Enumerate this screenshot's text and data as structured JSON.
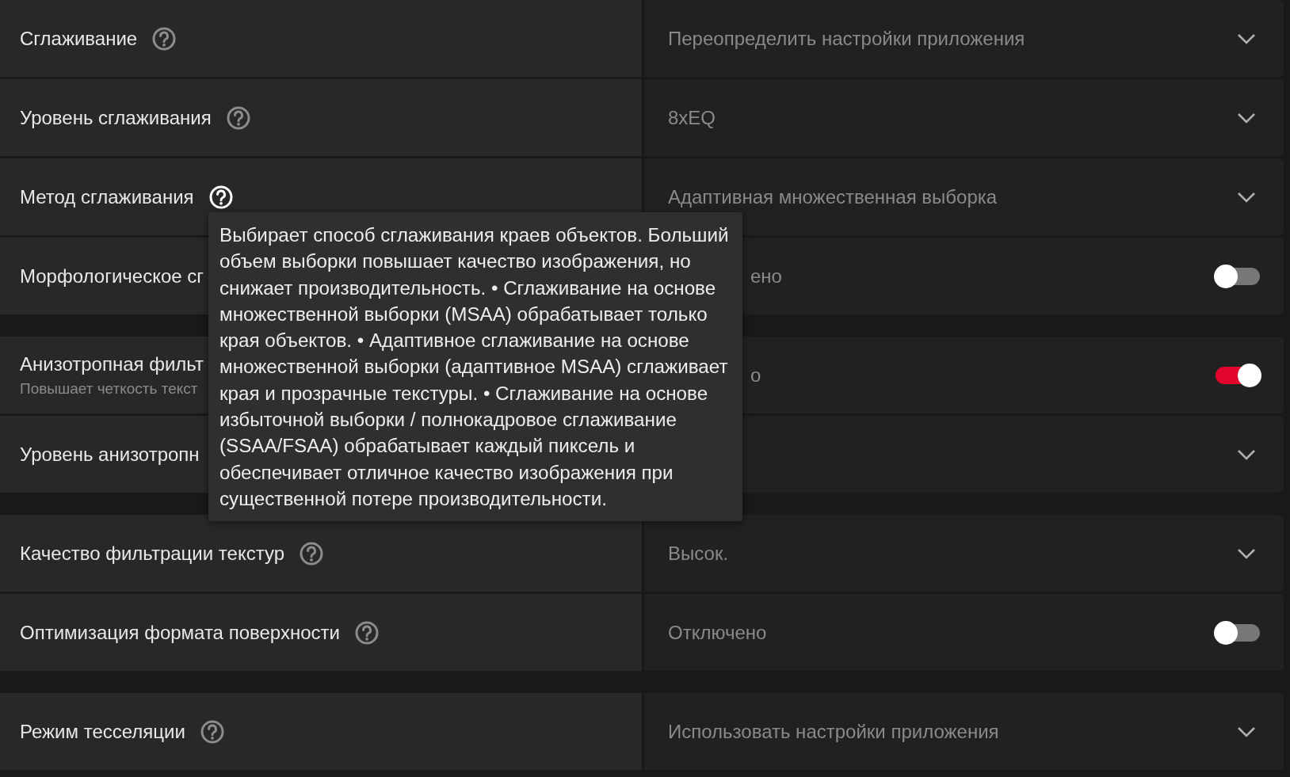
{
  "groups": [
    {
      "rows": [
        {
          "kind": "dropdown",
          "label": "Сглаживание",
          "help_active": false,
          "value": "Переопределить настройки приложения"
        },
        {
          "kind": "dropdown",
          "label": "Уровень сглаживания",
          "help_active": false,
          "value": "8xEQ"
        },
        {
          "kind": "dropdown",
          "label": "Метод сглаживания",
          "help_active": true,
          "value": "Адаптивная множественная выборка"
        },
        {
          "kind": "toggle",
          "label": "Морфологическое сг",
          "clipped": true,
          "value": "ено",
          "on": false
        }
      ]
    },
    {
      "rows": [
        {
          "kind": "toggle",
          "label": "Анизотропная фильт",
          "description": "Повышает четкость текст",
          "clipped": true,
          "value": "о",
          "on": true
        },
        {
          "kind": "dropdown",
          "label": "Уровень анизотропн"
        }
      ]
    },
    {
      "rows": [
        {
          "kind": "dropdown",
          "label": "Качество фильтрации текстур",
          "help_active": false,
          "value": "Высок."
        },
        {
          "kind": "toggle",
          "label": "Оптимизация формата поверхности",
          "help_active": false,
          "value": "Отключено",
          "on": false
        }
      ]
    },
    {
      "rows": [
        {
          "kind": "dropdown",
          "label": "Режим тесселяции",
          "help_active": false,
          "value": "Использовать настройки приложения"
        }
      ]
    }
  ],
  "tooltip": {
    "text": "Выбирает способ сглаживания краев объектов. Больший объем выборки повышает качество изображения, но снижает производительность. • Сглаживание на основе множественной выборки (MSAA) обрабатывает только края объектов. • Адаптивное сглаживание на основе множественной выборки (адаптивное MSAA) сглаживает края и прозрачные текстуры. • Сглаживание на основе избыточной выборки / полнокадровое сглаживание (SSAA/FSAA) обрабатывает каждый пиксель и обеспечивает отличное качество изображения при существенной потере производительности."
  }
}
